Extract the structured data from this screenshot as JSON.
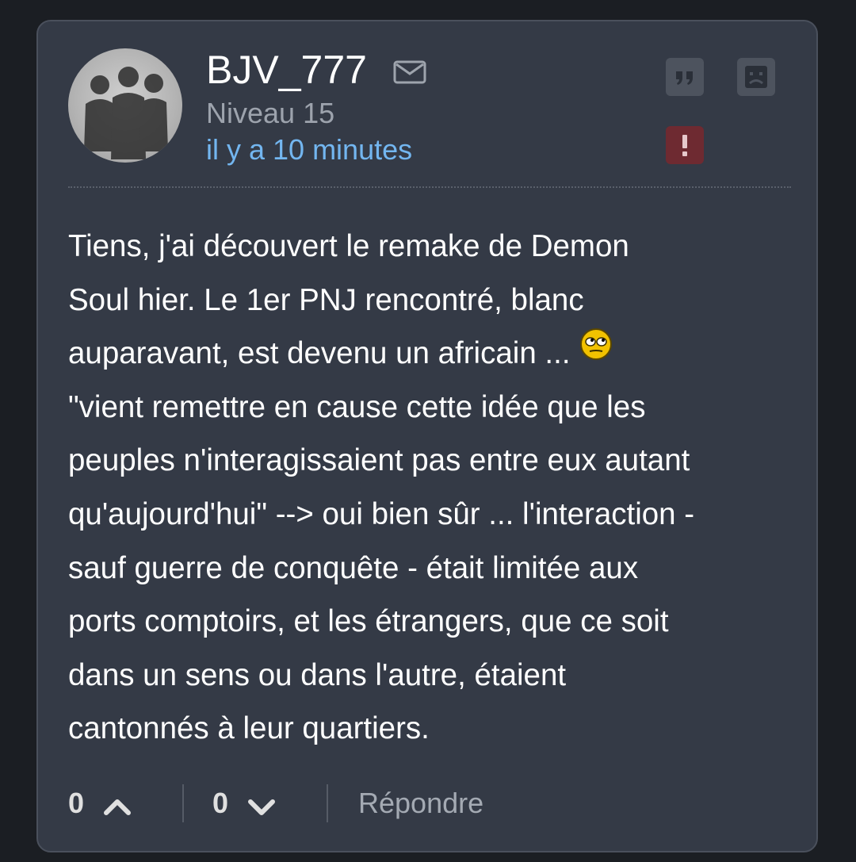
{
  "post": {
    "author": "BJV_777",
    "level": "Niveau 15",
    "timestamp": "il y a 10 minutes",
    "message_lines": [
      "Tiens, j'ai découvert le remake de Demon",
      "Soul hier. Le 1er PNJ rencontré, blanc",
      "auparavant, est devenu un africain ...",
      "\"vient remettre en cause cette idée que les",
      "peuples n'interagissaient pas entre eux autant",
      "qu'aujourd'hui\" --> oui bien sûr ... l'interaction -",
      "sauf guerre de conquête - était limitée aux",
      "ports comptoirs, et les étrangers, que ce soit",
      "dans un sens ou dans l'autre, étaient",
      "cantonnés à leur quartiers."
    ]
  },
  "icons": {
    "mail": "envelope-icon",
    "quote": "quote-icon",
    "sad": "sad-face-icon",
    "report": "exclamation-icon",
    "smiley": "rolling-eyes-smiley-icon",
    "upvote": "chevron-up-icon",
    "downvote": "chevron-down-icon"
  },
  "footer": {
    "upvotes": "0",
    "downvotes": "0",
    "reply_label": "Répondre"
  },
  "colors": {
    "card_background": "#343a46",
    "page_background": "#1b1e23",
    "timestamp": "#73b6f0",
    "report_button": "#6e2a31",
    "action_button": "#4d535e"
  }
}
